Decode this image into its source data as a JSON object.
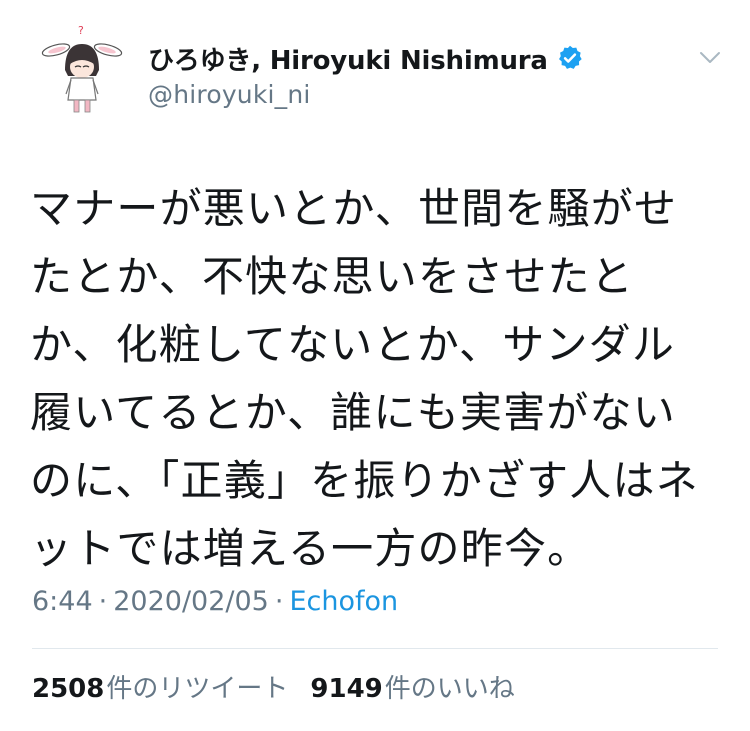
{
  "author": {
    "display_name": "ひろゆき, Hiroyuki Nishimura",
    "handle": "@hiroyuki_ni",
    "verified": true,
    "avatar_icon": "bunny-ear-character-avatar"
  },
  "tweet": {
    "text": "マナーが悪いとか、世間を騒がせたとか、不快な思いをさせたとか、化粧してないとか、サンダル履いてるとか、誰にも実害がないのに、「正義」を振りかざす人はネットでは増える一方の昨今。",
    "time": "6:44",
    "date": "2020/02/05",
    "separator": "·",
    "source": "Echofon"
  },
  "stats": {
    "retweets_count": "2508",
    "retweets_label": "件のリツイート",
    "likes_count": "9149",
    "likes_label": "件のいいね"
  },
  "colors": {
    "verified_blue": "#1da1f2",
    "link_blue": "#1b95e0",
    "secondary_text": "#657786",
    "divider": "#e1e8ed"
  }
}
